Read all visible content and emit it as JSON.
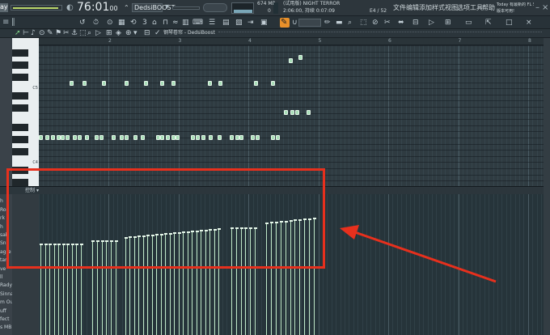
{
  "toolbar": {
    "corner": "ay",
    "time_big": "76:01",
    "time_small": "00",
    "preset": "DedsiBOOST",
    "cpu": "674 MB",
    "cpu_sub": "0",
    "title_small": "(试用版) NIGHT TERROR",
    "time_sub": "2:06:00, 持续 0:07:09",
    "counter": "E4 / 52",
    "menu": [
      "文件",
      "编辑",
      "添加",
      "样式",
      "视图",
      "选项",
      "工具",
      "帮助"
    ],
    "news_1": "Today 有最新的 FL Studio",
    "news_2": "版本可用!"
  },
  "piano_roll": {
    "header": "钢琴卷帘 - DedsiBoost",
    "bar_numbers": [
      "2",
      "3",
      "4",
      "5",
      "6",
      "7",
      "8"
    ],
    "key_labels": [
      "C5",
      "C4"
    ]
  },
  "left_panel": {
    "items": [
      "er",
      "h",
      "Rou",
      "rk",
      "h",
      "sab",
      "Sne",
      "agre",
      "tar",
      "ve",
      "ll",
      "Rady",
      "Sinna",
      "m Out",
      "uff",
      "fect",
      "s MB"
    ]
  },
  "control_lane": {
    "label": "控制",
    "caret": "▾"
  },
  "colors": {
    "note": "#a9dfb8",
    "annotation_red": "#e7301d",
    "accent_orange": "#e8902a"
  }
}
